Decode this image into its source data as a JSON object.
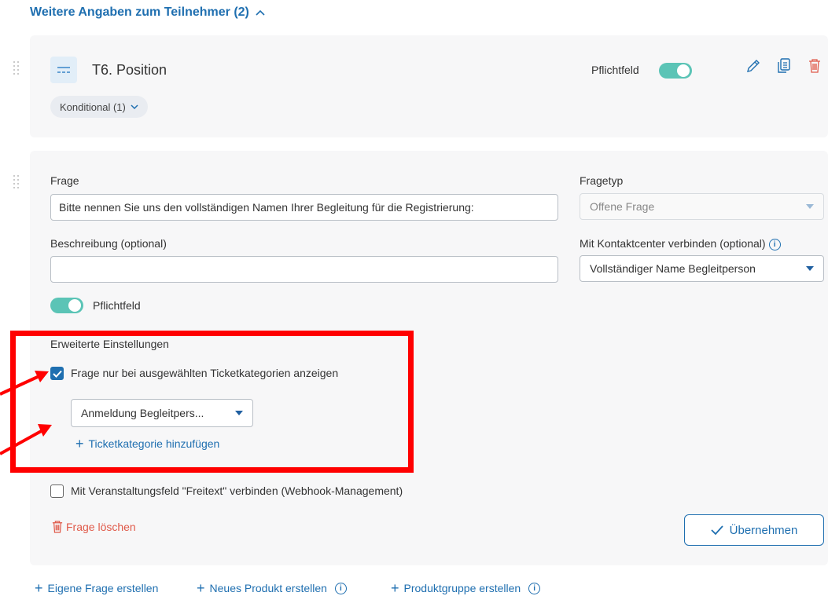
{
  "section": {
    "title": "Weitere Angaben zum Teilnehmer (2)",
    "toggle_icon": "chevron-up-icon"
  },
  "collapsed_question": {
    "title": "T6. Position",
    "conditional_label": "Konditional (1)",
    "required_label": "Pflichtfeld",
    "required_on": true,
    "icons": [
      "pencil-icon",
      "copy-icon",
      "trash-icon"
    ]
  },
  "editor": {
    "question_label": "Frage",
    "question_value": "Bitte nennen Sie uns den vollständigen Namen Ihrer Begleitung für die Registrierung:",
    "type_label": "Fragetyp",
    "type_value": "Offene Frage",
    "description_label": "Beschreibung (optional)",
    "description_value": "",
    "contact_label": "Mit Kontaktcenter verbinden (optional)",
    "contact_value": "Vollständiger Name Begleitperson",
    "required_label": "Pflichtfeld",
    "required_on": true,
    "advanced_label": "Erweiterte Einstellungen",
    "ticket_checkbox_label": "Frage nur bei ausgewählten Ticketkategorien anzeigen",
    "ticket_checked": true,
    "ticket_select_value": "Anmeldung Begleitpers...",
    "add_ticket_label": "Ticketkategorie hinzufügen",
    "webhook_checkbox_label": "Mit Veranstaltungsfeld \"Freitext\" verbinden (Webhook-Management)",
    "webhook_checked": false,
    "delete_label": "Frage löschen",
    "apply_label": "Übernehmen"
  },
  "footer_links": {
    "own_question": "Eigene Frage erstellen",
    "new_product": "Neues Produkt erstellen",
    "product_group": "Produktgruppe erstellen"
  },
  "colors": {
    "accent": "#1f6fb0",
    "toggle": "#5bc4b6",
    "danger": "#e05a4a",
    "annotation": "#ff0000"
  }
}
